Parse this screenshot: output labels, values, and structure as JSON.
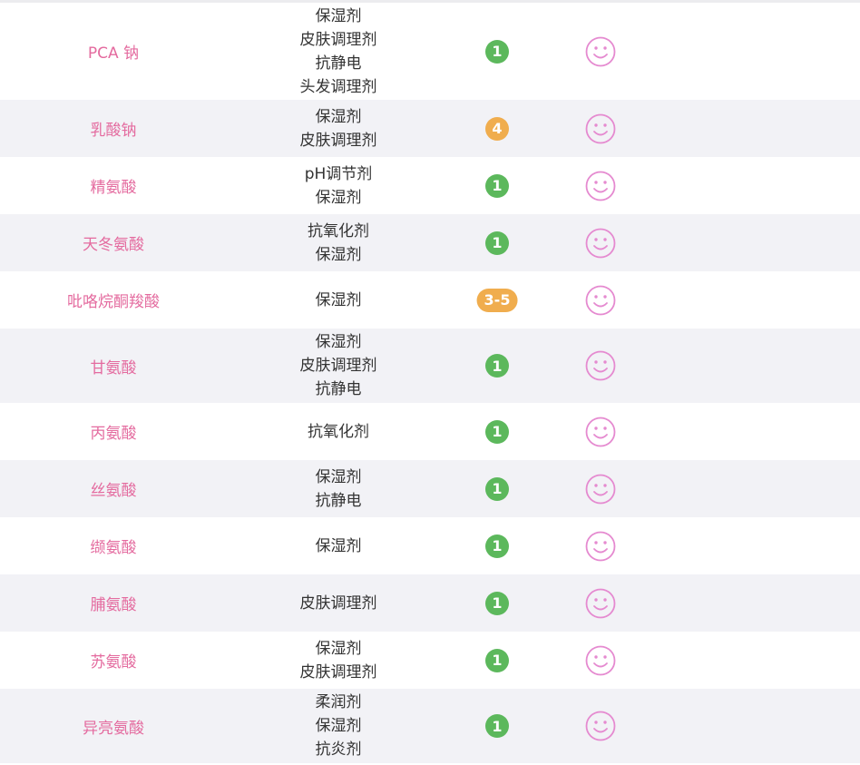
{
  "colors": {
    "name_pink": "#e46b9f",
    "safe_green": "#5cb85c",
    "warn_orange": "#f0ad4e",
    "row_alt": "#f2f2f6",
    "face_pink": "#e58ad0"
  },
  "rows": [
    {
      "name": "PCA 钠",
      "usage": [
        "保湿剂",
        "皮肤调理剂",
        "抗静电",
        "头发调理剂"
      ],
      "score": "1",
      "level": "green",
      "icon": "smile-face-icon"
    },
    {
      "name": "乳酸钠",
      "usage": [
        "保湿剂",
        "皮肤调理剂"
      ],
      "score": "4",
      "level": "orange",
      "icon": "smile-face-icon"
    },
    {
      "name": "精氨酸",
      "usage": [
        "pH调节剂",
        "保湿剂"
      ],
      "score": "1",
      "level": "green",
      "icon": "smile-face-icon"
    },
    {
      "name": "天冬氨酸",
      "usage": [
        "抗氧化剂",
        "保湿剂"
      ],
      "score": "1",
      "level": "green",
      "icon": "smile-face-icon"
    },
    {
      "name": "吡咯烷酮羧酸",
      "usage": [
        "保湿剂"
      ],
      "score": "3-5",
      "level": "orange",
      "icon": "smile-face-icon"
    },
    {
      "name": "甘氨酸",
      "usage": [
        "保湿剂",
        "皮肤调理剂",
        "抗静电"
      ],
      "score": "1",
      "level": "green",
      "icon": "smile-face-icon"
    },
    {
      "name": "丙氨酸",
      "usage": [
        "抗氧化剂"
      ],
      "score": "1",
      "level": "green",
      "icon": "smile-face-icon"
    },
    {
      "name": "丝氨酸",
      "usage": [
        "保湿剂",
        "抗静电"
      ],
      "score": "1",
      "level": "green",
      "icon": "smile-face-icon"
    },
    {
      "name": "缬氨酸",
      "usage": [
        "保湿剂"
      ],
      "score": "1",
      "level": "green",
      "icon": "smile-face-icon"
    },
    {
      "name": "脯氨酸",
      "usage": [
        "皮肤调理剂"
      ],
      "score": "1",
      "level": "green",
      "icon": "smile-face-icon"
    },
    {
      "name": "苏氨酸",
      "usage": [
        "保湿剂",
        "皮肤调理剂"
      ],
      "score": "1",
      "level": "green",
      "icon": "smile-face-icon"
    },
    {
      "name": "异亮氨酸",
      "usage": [
        "柔润剂",
        "保湿剂",
        "抗炎剂"
      ],
      "score": "1",
      "level": "green",
      "icon": "smile-face-icon"
    }
  ]
}
